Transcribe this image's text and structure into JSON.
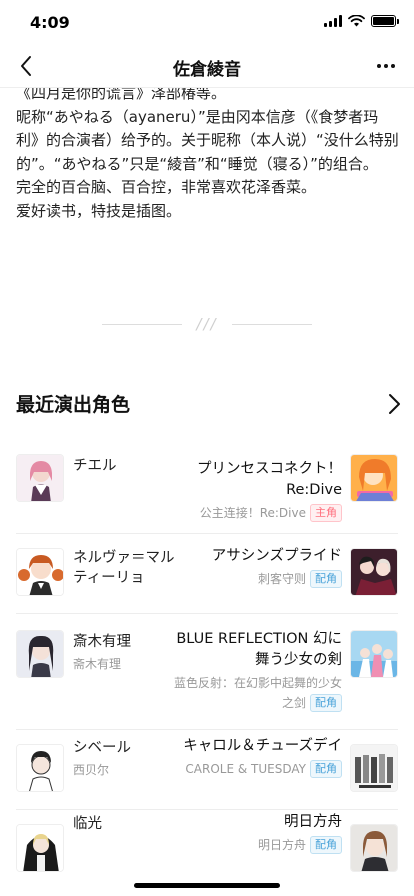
{
  "status": {
    "time": "4:09"
  },
  "nav": {
    "title": "佐倉綾音"
  },
  "bio": {
    "lines": [
      "《四月是你的谎言》泽部椿等。",
      "昵称“あやねる（ayaneru）”是由冈本信彦（《食梦者玛利》的合演者）给予的。关于昵称（本人说）“没什么特别的”。“あやねる”只是“綾音”和“睡觉（寝る）”的组合。",
      "完全的百合脑、百合控，非常喜欢花泽香菜。",
      "爱好读书，特技是插图。"
    ]
  },
  "divider": {
    "mark": "///"
  },
  "section": {
    "title": "最近演出角色"
  },
  "roles": [
    {
      "char_name": "チエル",
      "char_sub": "",
      "work_title": "プリンセスコネクト！Re:Dive",
      "work_sub": "公主连接！Re:Dive",
      "badge": "主角"
    },
    {
      "char_name": "ネルヴァ＝マルティーリョ",
      "char_sub": "",
      "work_title": "アサシンズプライド",
      "work_sub": "刺客守则",
      "badge": "配角"
    },
    {
      "char_name": "斎木有理",
      "char_sub": "斋木有理",
      "work_title": "BLUE REFLECTION 幻に舞う少女の剣",
      "work_sub": "蓝色反射：在幻影中起舞的少女之剑",
      "badge": "配角"
    },
    {
      "char_name": "シベール",
      "char_sub": "西贝尔",
      "work_title": "キャロル＆チューズデイ",
      "work_sub": "CAROLE & TUESDAY",
      "badge": "配角"
    },
    {
      "char_name": "临光",
      "char_sub": "",
      "work_title": "明日方舟",
      "work_sub": "明日方舟",
      "badge": "配角"
    }
  ],
  "colors": {
    "main_badge": "#ff6f7d",
    "support_badge": "#4aa3d9",
    "divider": "#dddddd"
  }
}
